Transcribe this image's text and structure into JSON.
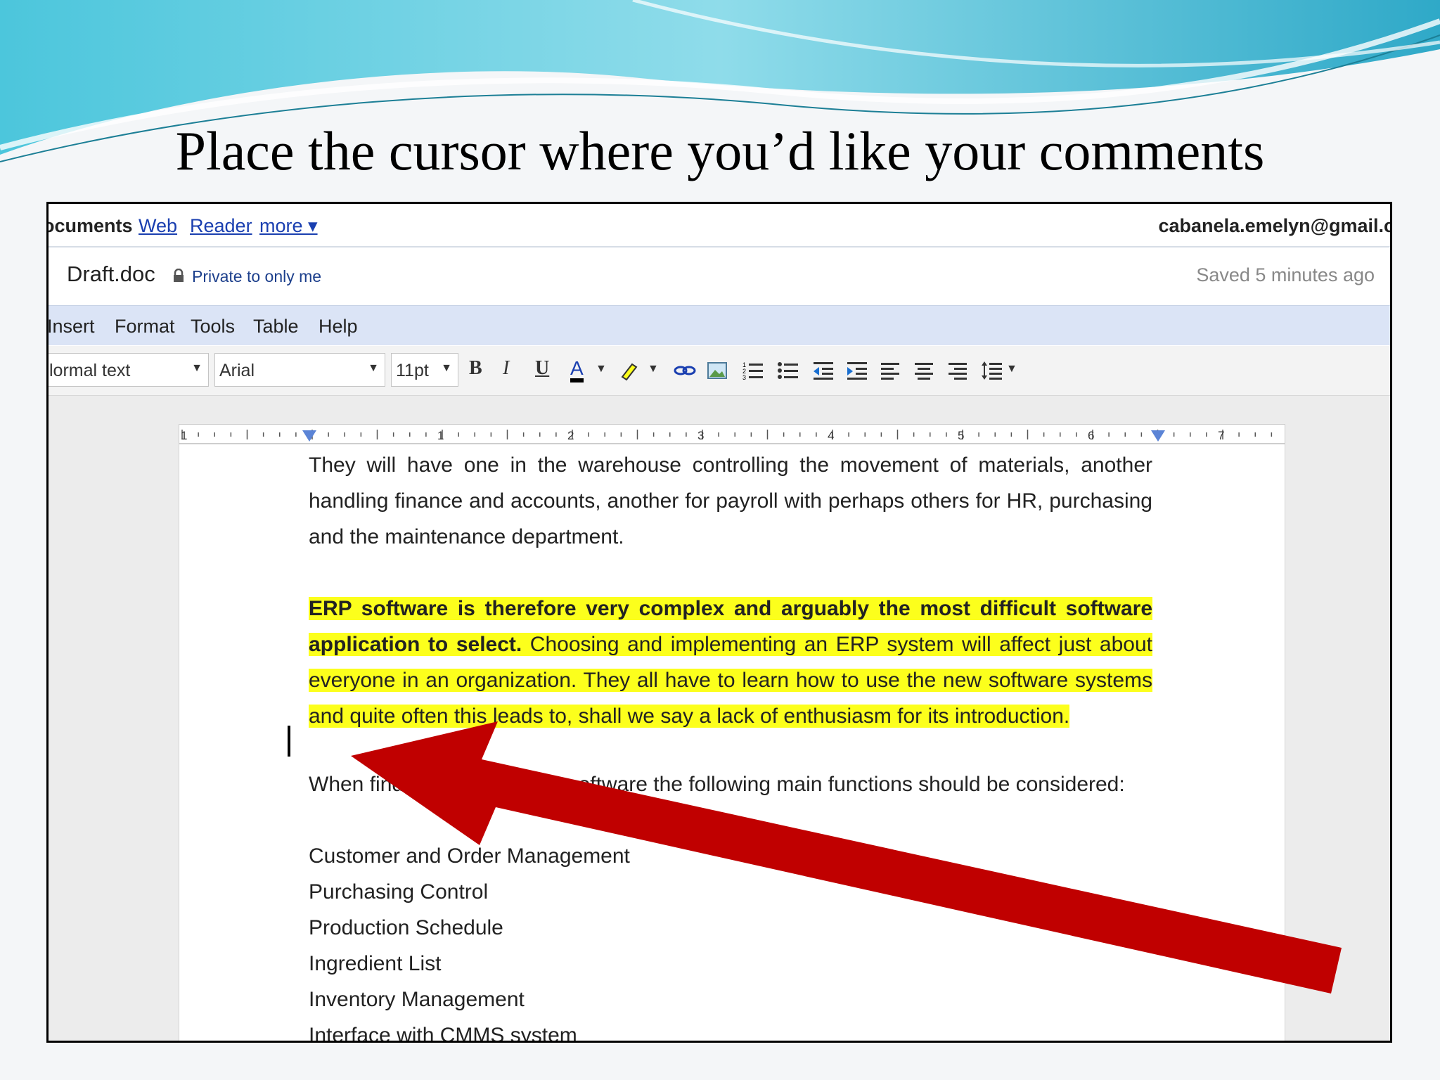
{
  "slide": {
    "title": "Place the cursor where you’d like your comments"
  },
  "topbar": {
    "docs_label": "ocuments",
    "links": [
      "Web",
      "Reader",
      "more ▾"
    ],
    "email": "cabanela.emelyn@gmail.c"
  },
  "document": {
    "file_name": "Draft.doc",
    "privacy": "Private to only me",
    "save_status": "Saved 5 minutes ago"
  },
  "menu": {
    "items": [
      "Insert",
      "Format",
      "Tools",
      "Table",
      "Help"
    ]
  },
  "toolbar": {
    "style_value": "lormal text",
    "font_value": "Arial",
    "size_value": "11pt",
    "bold": "B",
    "italic": "I",
    "underline": "U",
    "text_color": "A"
  },
  "ruler": {
    "labels": [
      "1",
      "1",
      "2",
      "3",
      "4",
      "5",
      "6",
      "7"
    ]
  },
  "content": {
    "para1": "They will have one in the warehouse controlling the movement of materials, another handling finance and accounts, another for payroll with perhaps others for HR, purchasing and the maintenance department.",
    "para2_bold": "ERP software is therefore very complex and arguably the most difficult software application to select.",
    "para2_rest": " Choosing and implementing an ERP system will affect just about everyone in an organization. They all have to learn how to use the new software systems and quite often this leads to, shall we say a lack of enthusiasm for its introduction.",
    "functions_intro": "When finding and selecting software the following main functions should be considered:",
    "functions": [
      "Customer and Order Management",
      "Purchasing Control",
      "Production Schedule",
      "Ingredient List",
      "Inventory Management",
      "Interface with CMMS system"
    ]
  },
  "colors": {
    "highlight": "#fcff1c",
    "arrow": "#c00000",
    "menubar": "#dbe4f6",
    "link": "#1a3fb0"
  }
}
